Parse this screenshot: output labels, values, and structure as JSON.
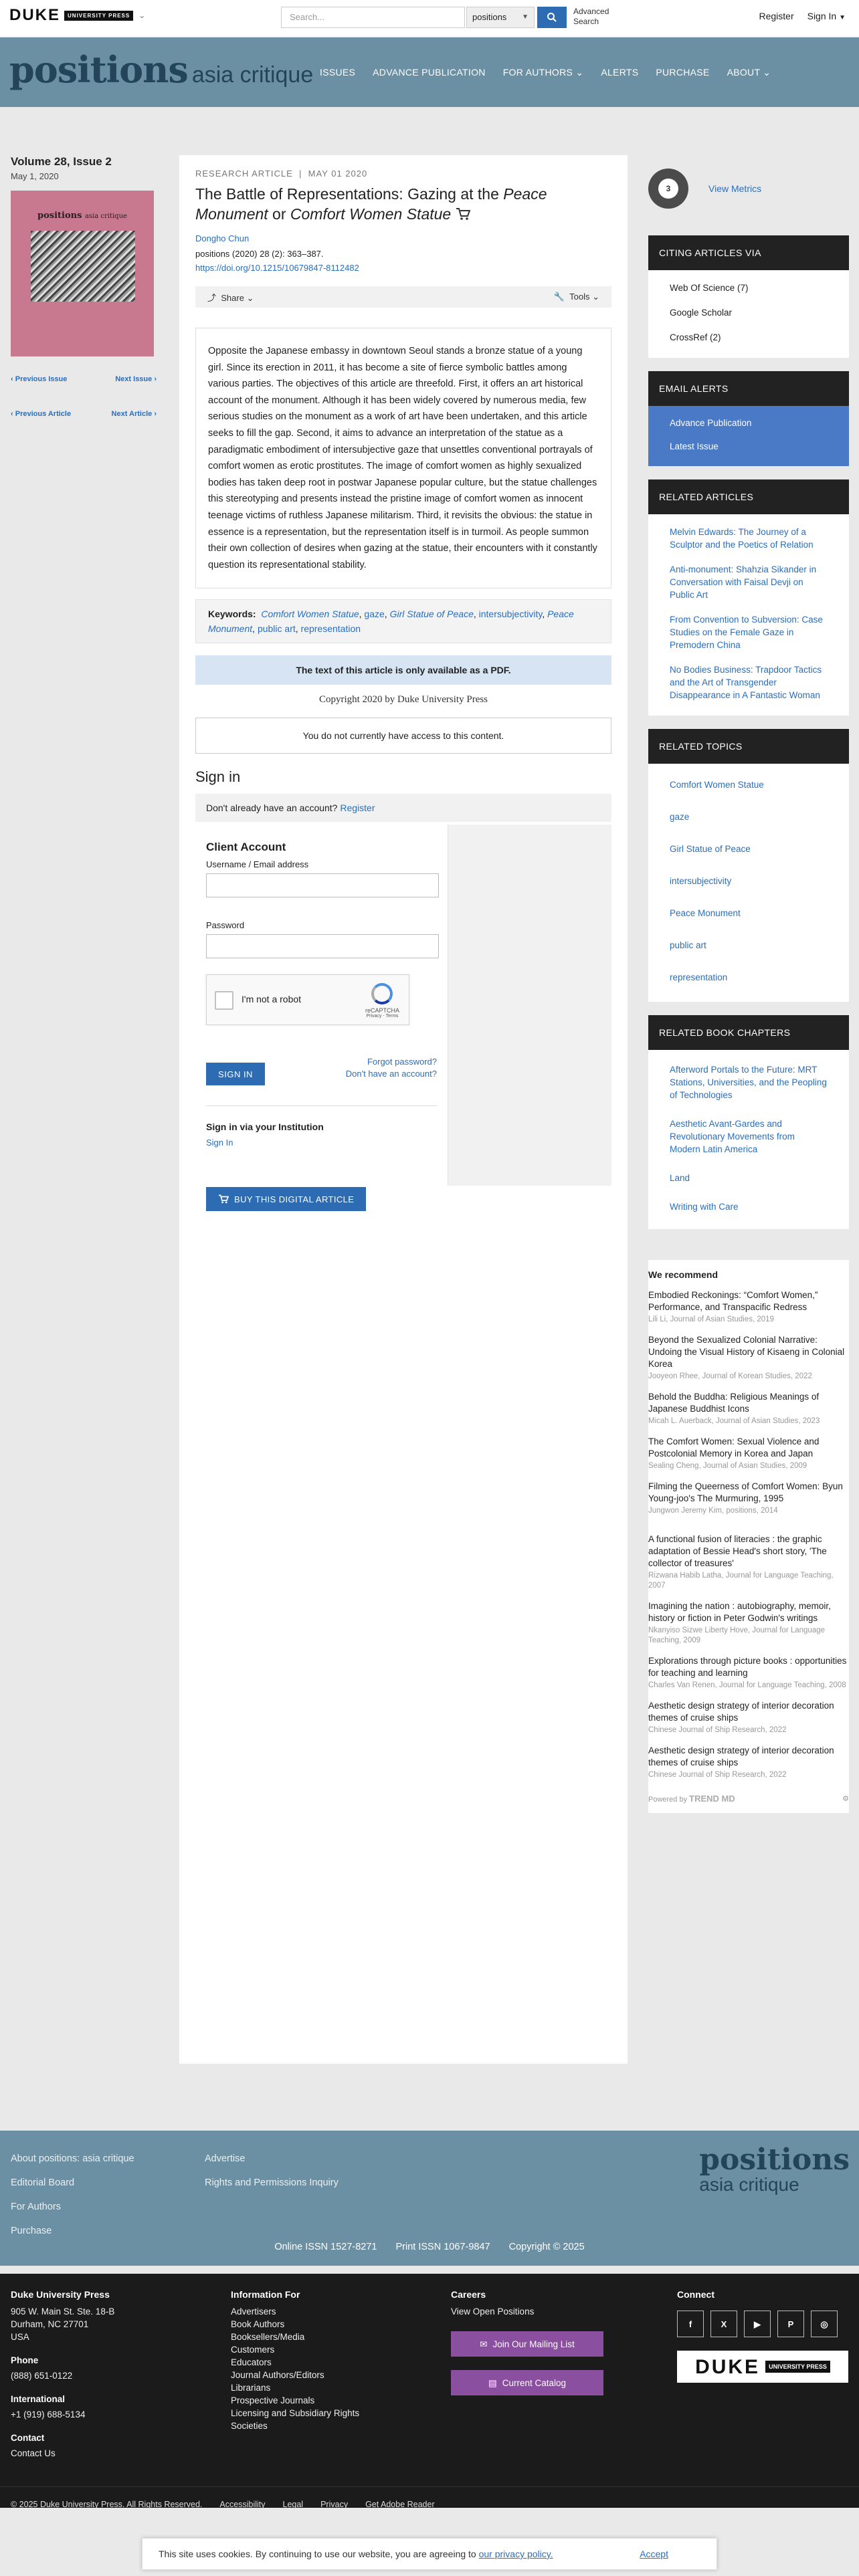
{
  "topbar": {
    "logo_word": "DUKE",
    "logo_box": "UNIVERSITY PRESS",
    "search_placeholder": "Search...",
    "search_scope": "positions",
    "advanced_search": "Advanced Search",
    "register": "Register",
    "sign_in": "Sign In"
  },
  "masthead": {
    "logo_big": "positions",
    "logo_small": "asia critique",
    "nav": [
      "ISSUES",
      "ADVANCE PUBLICATION",
      "FOR AUTHORS",
      "ALERTS",
      "PURCHASE",
      "ABOUT"
    ]
  },
  "issue": {
    "volume": "Volume 28, Issue 2",
    "date": "May 1, 2020",
    "cover_title": "positions",
    "cover_subtitle": "asia critique",
    "prev_issue": "Previous Issue",
    "next_issue": "Next Issue",
    "prev_article": "Previous Article",
    "next_article": "Next Article"
  },
  "article": {
    "type": "Research Article",
    "date": "May 01 2020",
    "title_a": "The Battle of Representations: Gazing at the ",
    "title_b": "Peace Monument",
    "title_c": " or ",
    "title_d": "Comfort Women Statue",
    "author": "Dongho Chun",
    "citation": "positions (2020) 28 (2): 363–387.",
    "doi": "https://doi.org/10.1215/10679847-8112482",
    "share": "Share",
    "tools": "Tools",
    "abstract": "Opposite the Japanese embassy in downtown Seoul stands a bronze statue of a young girl. Since its erection in 2011, it has become a site of fierce symbolic battles among various parties. The objectives of this article are threefold. First, it offers an art historical account of the monument. Although it has been widely covered by numerous media, few serious studies on the monument as a work of art have been undertaken, and this article seeks to fill the gap. Second, it aims to advance an interpretation of the statue as a paradigmatic embodiment of intersubjective gaze that unsettles conventional portrayals of comfort women as erotic prostitutes. The image of comfort women as highly sexualized bodies has taken deep root in postwar Japanese popular culture, but the statue challenges this stereotyping and presents instead the pristine image of comfort women as innocent teenage victims of ruthless Japanese militarism. Third, it revisits the obvious: the statue in essence is a representation, but the representation itself is in turmoil. As people summon their own collection of desires when gazing at the statue, their encounters with it constantly question its representational stability.",
    "keywords_label": "Keywords:",
    "keywords": [
      "Comfort Women Statue",
      "gaze",
      "Girl Statue of Peace",
      "intersubjectivity",
      "Peace Monument",
      "public art",
      "representation"
    ],
    "pdf_note": "The text of this article is only available as a PDF.",
    "copyright": "Copyright 2020 by Duke University Press",
    "no_access": "You do not currently have access to this content."
  },
  "signin": {
    "heading": "Sign in",
    "no_account": "Don't already have an account?",
    "register": "Register",
    "client_heading": "Client Account",
    "username_label": "Username / Email address",
    "password_label": "Password",
    "captcha_text": "I'm not a robot",
    "captcha_brand": "reCAPTCHA",
    "captcha_terms": "Privacy - Terms",
    "forgot": "Forgot password?",
    "no_account_q": "Don't have an account?",
    "signin_button": "SIGN IN",
    "inst_heading": "Sign in via your Institution",
    "inst_link": "Sign In",
    "buy": "BUY THIS DIGITAL ARTICLE"
  },
  "sidebar": {
    "metrics_score": "3",
    "view_metrics": "View Metrics",
    "citing_h": "CITING ARTICLES VIA",
    "citing": [
      "Web Of Science (7)",
      "Google Scholar",
      "CrossRef (2)"
    ],
    "alerts_h": "EMAIL ALERTS",
    "alerts": [
      "Advance Publication",
      "Latest Issue"
    ],
    "related_articles_h": "RELATED ARTICLES",
    "related_articles": [
      "Melvin Edwards: The Journey of a Sculptor and the Poetics of Relation",
      "Anti-monument: Shahzia Sikander in Conversation with Faisal Devji on Public Art",
      "From Convention to Subversion: Case Studies on the Female Gaze in Premodern China",
      "No Bodies Business: Trapdoor Tactics and the Art of Transgender Disappearance in A Fantastic Woman"
    ],
    "related_topics_h": "RELATED TOPICS",
    "related_topics": [
      "Comfort Women Statue",
      "gaze",
      "Girl Statue of Peace",
      "intersubjectivity",
      "Peace Monument",
      "public art",
      "representation"
    ],
    "related_chapters_h": "RELATED BOOK CHAPTERS",
    "related_chapters": [
      "Afterword Portals to the Future: MRT Stations, Universities, and the Peopling of Technologies",
      "Aesthetic Avant-Gardes and Revolutionary Movements from Modern Latin America",
      "Land",
      "Writing with Care"
    ],
    "recommend_h": "We recommend",
    "recommend": [
      {
        "title": "Embodied Reckonings: “Comfort Women,” Performance, and Transpacific Redress",
        "src": "Lili Li, Journal of Asian Studies, 2019"
      },
      {
        "title": "Beyond the Sexualized Colonial Narrative: Undoing the Visual History of Kisaeng in Colonial Korea",
        "src": "Jooyeon Rhee, Journal of Korean Studies, 2022"
      },
      {
        "title": "Behold the Buddha: Religious Meanings of Japanese Buddhist Icons",
        "src": "Micah L. Auerback, Journal of Asian Studies, 2023"
      },
      {
        "title": "The Comfort Women: Sexual Violence and Postcolonial Memory in Korea and Japan",
        "src": "Sealing Cheng, Journal of Asian Studies, 2009"
      },
      {
        "title": "Filming the Queerness of Comfort Women: Byun Young-joo's The Murmuring, 1995",
        "src": "Jungwon Jeremy Kim, positions, 2014"
      },
      {
        "title": "A functional fusion of literacies : the graphic adaptation of Bessie Head's short story, 'The collector of treasures'",
        "src": "Rizwana Habib Latha, Journal for Language Teaching, 2007"
      },
      {
        "title": "Imagining the nation : autobiography, memoir, history or fiction in Peter Godwin's writings",
        "src": "Nkanyiso Sizwe Liberty Hove, Journal for Language Teaching, 2009"
      },
      {
        "title": "Explorations through picture books : opportunities for teaching and learning",
        "src": "Charles Van Renen, Journal for Language Teaching, 2008"
      },
      {
        "title": "Aesthetic design strategy of interior decoration themes of cruise ships",
        "src": "Chinese Journal of Ship Research, 2022"
      },
      {
        "title": "Aesthetic design strategy of interior decoration themes of cruise ships",
        "src": "Chinese Journal of Ship Research, 2022"
      }
    ],
    "powered_by": "Powered by",
    "trendmd": "TREND MD"
  },
  "footer": {
    "col_a": [
      "About positions: asia critique",
      "Editorial Board",
      "For Authors",
      "Purchase"
    ],
    "col_b": [
      "Advertise",
      "Rights and Permissions Inquiry"
    ],
    "logo_big": "positions",
    "logo_small": "asia critique",
    "online_issn": "Online ISSN 1527-8271",
    "print_issn": "Print ISSN 1067-9847",
    "copyright": "Copyright © 2025",
    "press_h": "Duke University Press",
    "address": [
      "905 W. Main St. Ste. 18-B",
      "Durham, NC 27701",
      "USA"
    ],
    "phone_h": "Phone",
    "phone": "(888) 651-0122",
    "intl_h": "International",
    "intl": "+1 (919) 688-5134",
    "contact_h": "Contact",
    "contact": "Contact Us",
    "info_h": "Information For",
    "info": [
      "Advertisers",
      "Book Authors",
      "Booksellers/Media",
      "Customers",
      "Educators",
      "Journal Authors/Editors",
      "Librarians",
      "Prospective Journals",
      "Licensing and Subsidiary Rights",
      "Societies"
    ],
    "careers_h": "Careers",
    "careers": "View Open Positions",
    "mailing": "Join Our Mailing List",
    "catalog": "Current Catalog",
    "connect_h": "Connect",
    "social": [
      "f",
      "X",
      "▶",
      "P",
      "◎"
    ],
    "duke_word": "DUKE",
    "duke_box": "UNIVERSITY PRESS",
    "legal": [
      "© 2025 Duke University Press. All Rights Reserved.",
      "Accessibility",
      "Legal",
      "Privacy",
      "Get Adobe Reader"
    ]
  },
  "cookie": {
    "text": "This site uses cookies. By continuing to use our website, you are agreeing to",
    "link": "our privacy policy.",
    "accept": "Accept"
  }
}
